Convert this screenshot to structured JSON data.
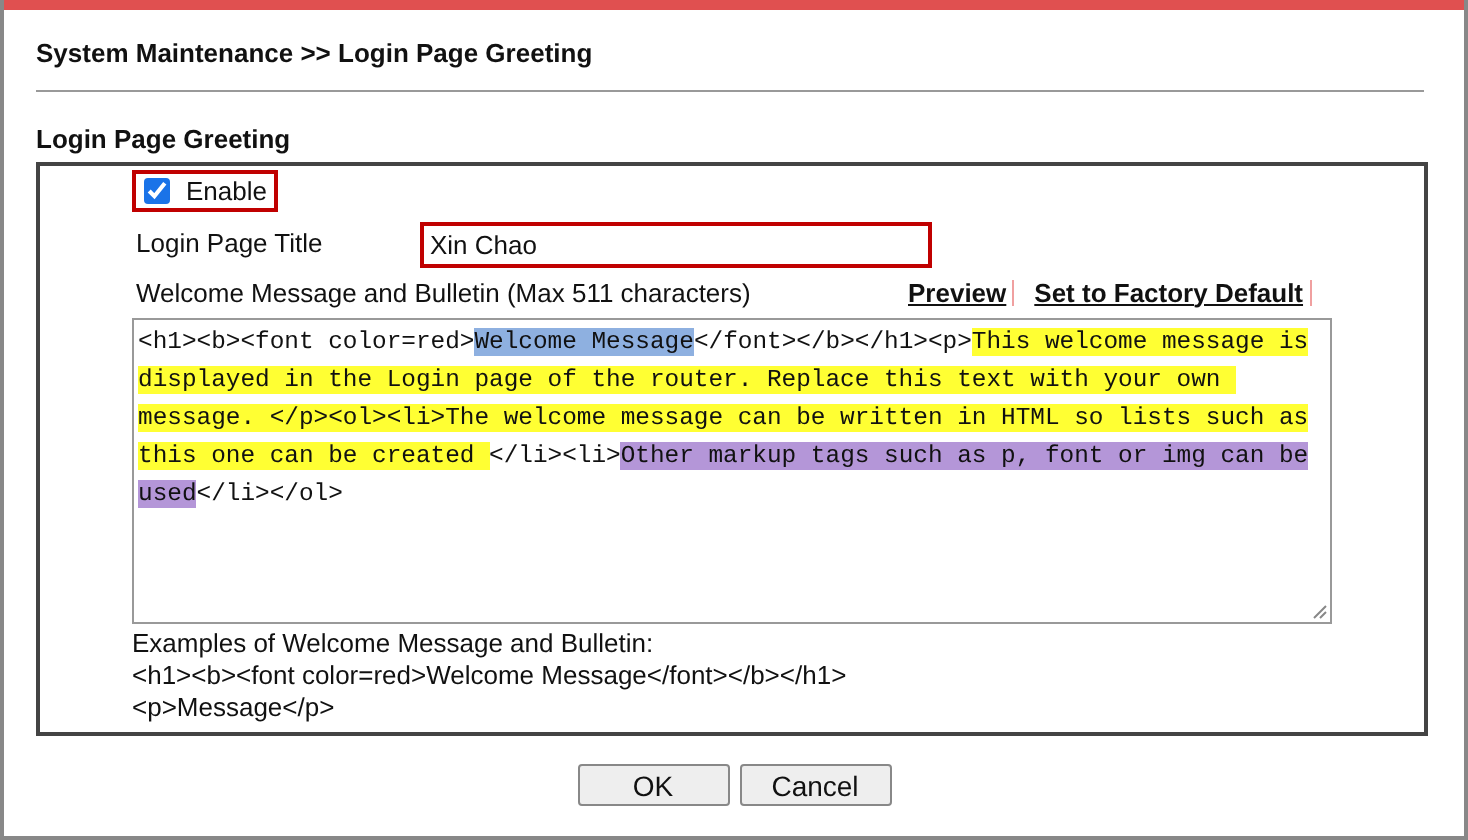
{
  "breadcrumb": "System Maintenance >> Login Page Greeting",
  "section_title": "Login Page Greeting",
  "enable": {
    "label": "Enable",
    "checked": true
  },
  "title_field": {
    "label": "Login Page Title",
    "value": "Xin Chao"
  },
  "message": {
    "label": "Welcome Message and Bulletin (Max 511 characters)",
    "links": [
      "Preview",
      "Set to Factory Default"
    ],
    "lines": [
      [
        {
          "text": "<h1><b><font color=red>"
        },
        {
          "text": "Welcome Message",
          "color": "#8eb0e0"
        },
        {
          "text": "</font></b></h1><p>"
        },
        {
          "text": "This welcome message is",
          "color": "#ffff33"
        }
      ],
      [
        {
          "text": "displayed in the Login page of the router. Replace this text with your own ",
          "color": "#ffff33"
        }
      ],
      [
        {
          "text": "message. </p><ol><li>The welcome message can be written in HTML so lists such as",
          "color": "#ffff33"
        }
      ],
      [
        {
          "text": "this one can be created ",
          "color": "#ffff33"
        },
        {
          "text": "</li><li>"
        },
        {
          "text": "Other markup tags such as p, font or img can be",
          "color": "#b496d8"
        }
      ],
      [
        {
          "text": "used",
          "color": "#b496d8"
        },
        {
          "text": "</li></ol>"
        }
      ]
    ]
  },
  "examples": [
    "Examples of Welcome Message and Bulletin:",
    "<h1><b><font color=red>Welcome Message</font></b></h1>",
    "<p>Message</p>"
  ],
  "buttons": [
    "OK",
    "Cancel"
  ]
}
